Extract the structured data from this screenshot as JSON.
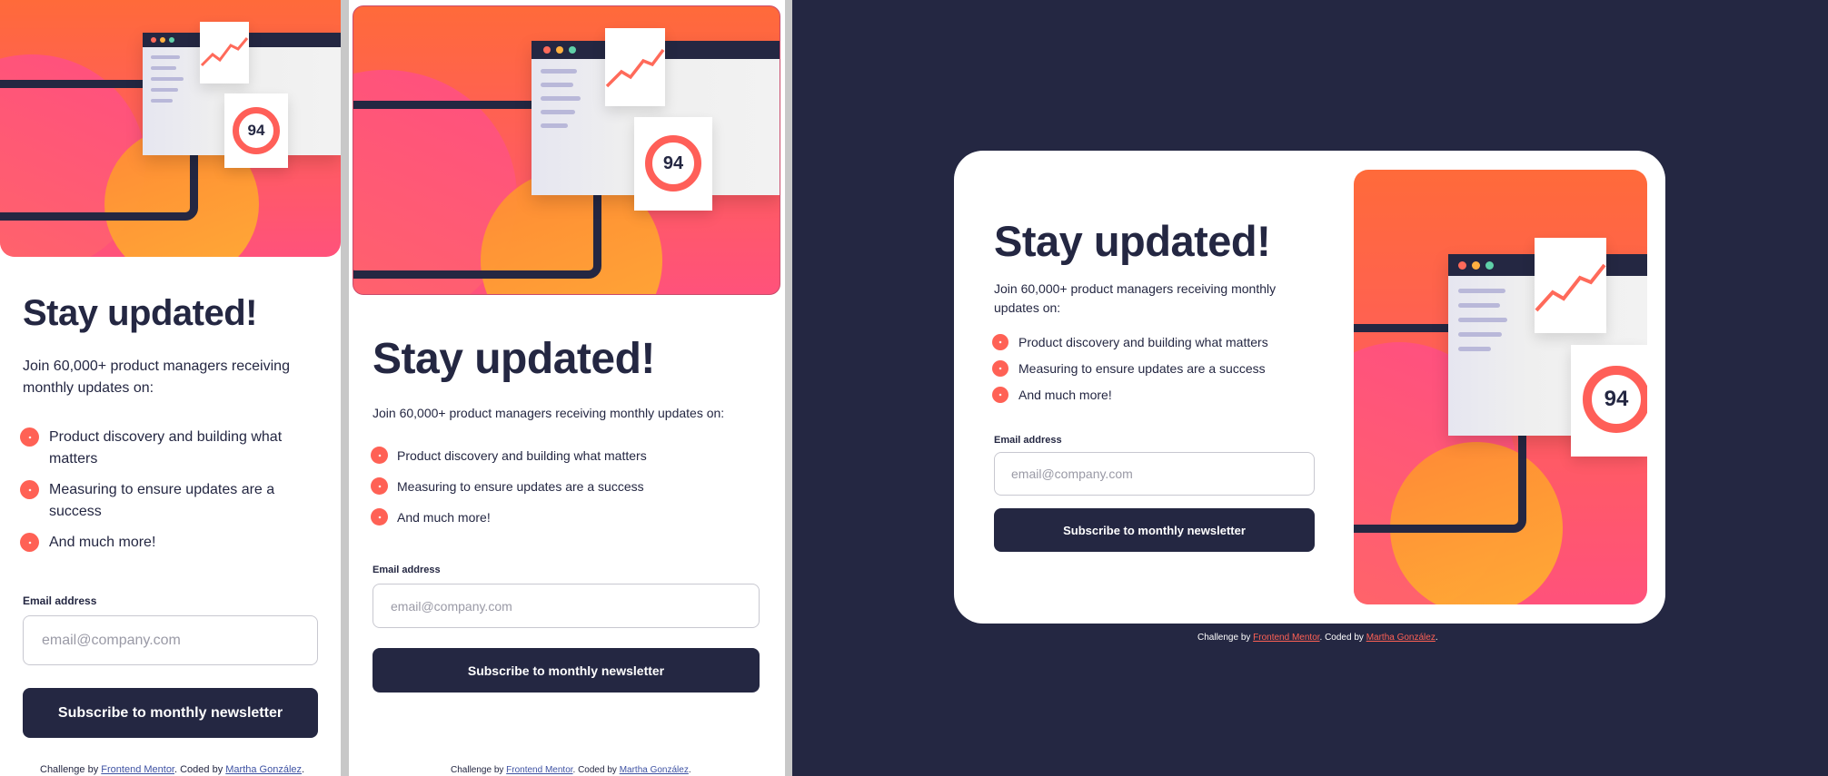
{
  "content": {
    "heading": "Stay updated!",
    "intro": "Join 60,000+ product managers receiving monthly updates on:",
    "features": [
      "Product discovery and building what matters",
      "Measuring to ensure updates are a success",
      "And much more!"
    ],
    "email_label": "Email address",
    "email_placeholder": "email@company.com",
    "button_label": "Subscribe to monthly newsletter",
    "score": "94",
    "footer": {
      "challenge_prefix": "Challenge by ",
      "challenge_link": "Frontend Mentor",
      "coded_prefix": ". Coded by ",
      "author_link": "Martha González",
      "suffix": "."
    }
  },
  "colors": {
    "dark_navy": "#242742",
    "tomato": "#ff6155",
    "gradient_top": "#ff6a3a",
    "gradient_bottom": "#ff527b",
    "white": "#ffffff"
  },
  "icons": [
    "check-icon",
    "trend-chart-icon",
    "score-ring-icon",
    "window-dot-icon"
  ]
}
